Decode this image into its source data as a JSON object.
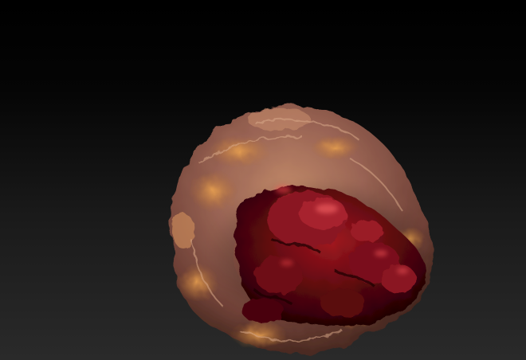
{
  "scene": {
    "background_top": "#000000",
    "background_bottom": "#2a2a2a",
    "object": "organic-sculpt-blob",
    "outer_skin_color": "#a8705a",
    "highlight_color": "#e8a050",
    "inner_flesh_color": "#6a0a12",
    "glint_color": "#ff5050"
  }
}
